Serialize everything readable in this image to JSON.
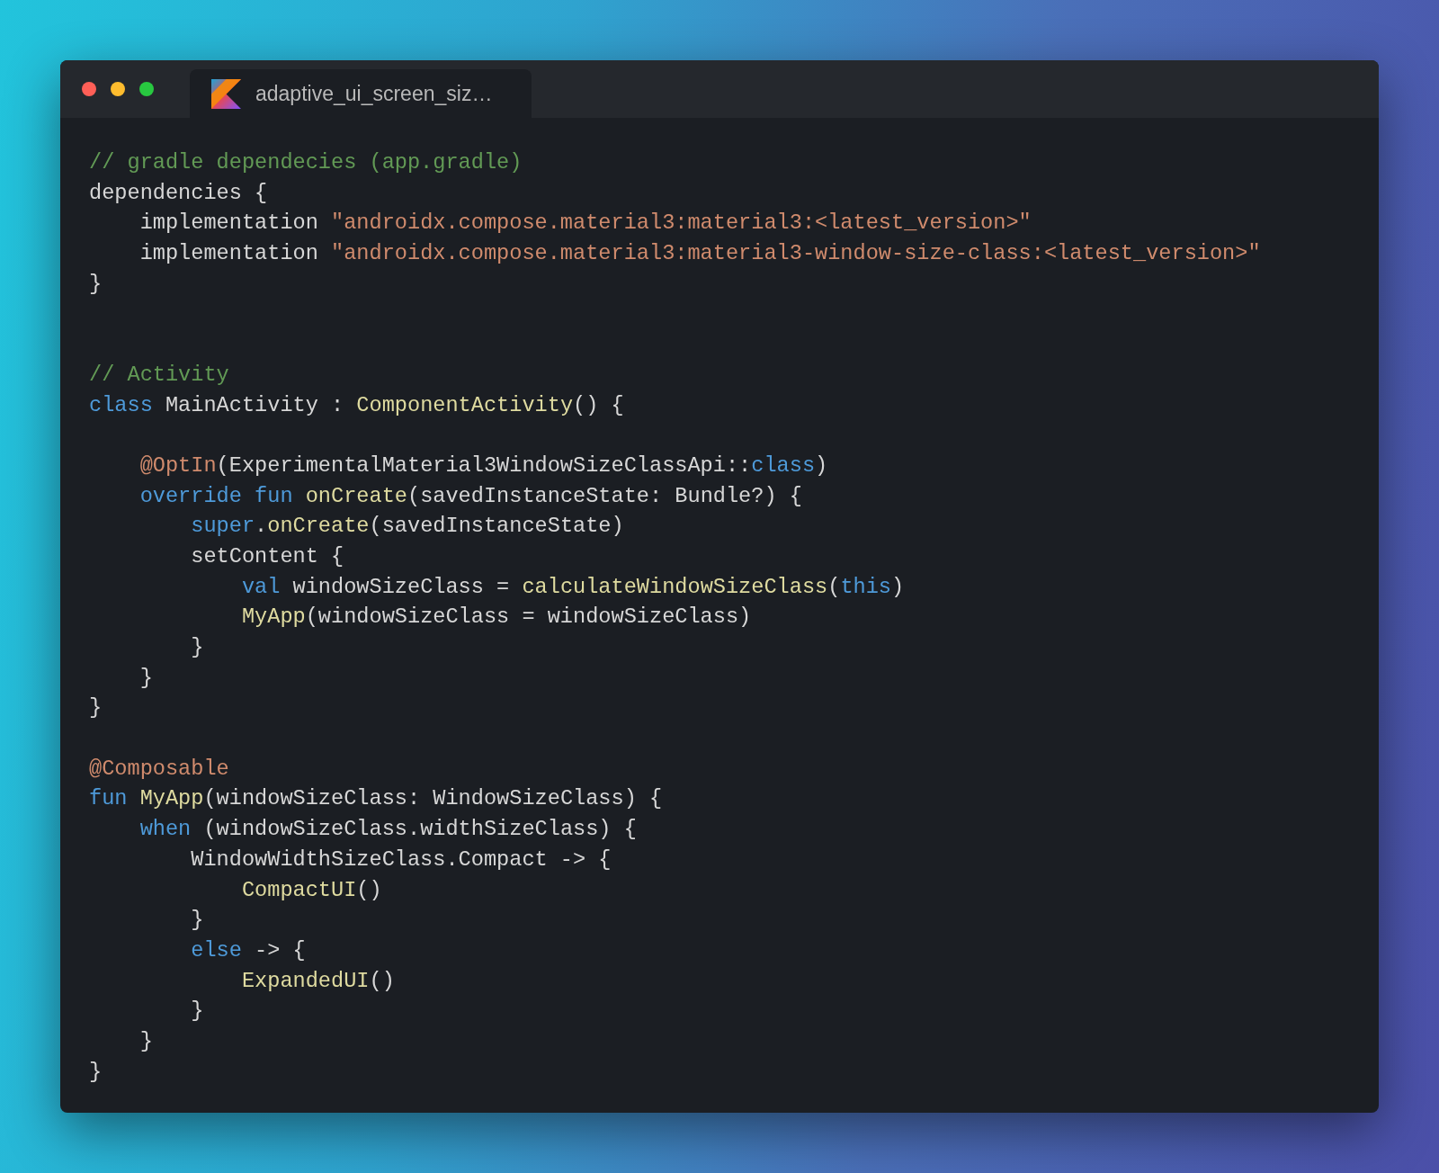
{
  "window": {
    "traffic_lights": [
      {
        "color": "#ff5f57"
      },
      {
        "color": "#febc2e"
      },
      {
        "color": "#28c840"
      }
    ],
    "tab": {
      "title": "adaptive_ui_screen_siz…"
    }
  },
  "code": [
    {
      "kind": "code",
      "tokens": [
        {
          "kind": "comment",
          "text": "// gradle dependecies (app.gradle)"
        }
      ]
    },
    {
      "kind": "code",
      "tokens": [
        {
          "kind": "plain",
          "text": "dependencies {"
        }
      ]
    },
    {
      "kind": "code",
      "tokens": [
        {
          "kind": "plain",
          "text": "    implementation "
        },
        {
          "kind": "string",
          "text": "\"androidx.compose.material3:material3:<latest_version>\""
        }
      ]
    },
    {
      "kind": "code",
      "tokens": [
        {
          "kind": "plain",
          "text": "    implementation "
        },
        {
          "kind": "string",
          "text": "\"androidx.compose.material3:material3-window-size-class:<latest_version>\""
        }
      ]
    },
    {
      "kind": "code",
      "tokens": [
        {
          "kind": "plain",
          "text": "}"
        }
      ]
    },
    {
      "kind": "blank"
    },
    {
      "kind": "blank"
    },
    {
      "kind": "code",
      "tokens": [
        {
          "kind": "comment",
          "text": "// Activity"
        }
      ]
    },
    {
      "kind": "code",
      "tokens": [
        {
          "kind": "keyword",
          "text": "class"
        },
        {
          "kind": "plain",
          "text": " MainActivity : "
        },
        {
          "kind": "function",
          "text": "ComponentActivity"
        },
        {
          "kind": "plain",
          "text": "() {"
        }
      ]
    },
    {
      "kind": "blank"
    },
    {
      "kind": "code",
      "tokens": [
        {
          "kind": "annotation",
          "text": "    @OptIn"
        },
        {
          "kind": "plain",
          "text": "(ExperimentalMaterial3WindowSizeClassApi::"
        },
        {
          "kind": "keyword",
          "text": "class"
        },
        {
          "kind": "plain",
          "text": ")"
        }
      ]
    },
    {
      "kind": "code",
      "tokens": [
        {
          "kind": "keyword",
          "text": "    override fun "
        },
        {
          "kind": "function",
          "text": "onCreate"
        },
        {
          "kind": "plain",
          "text": "(savedInstanceState: Bundle?) {"
        }
      ]
    },
    {
      "kind": "code",
      "tokens": [
        {
          "kind": "keyword",
          "text": "        super"
        },
        {
          "kind": "plain",
          "text": "."
        },
        {
          "kind": "function",
          "text": "onCreate"
        },
        {
          "kind": "plain",
          "text": "(savedInstanceState)"
        }
      ]
    },
    {
      "kind": "code",
      "tokens": [
        {
          "kind": "plain",
          "text": "        setContent {"
        }
      ]
    },
    {
      "kind": "code",
      "tokens": [
        {
          "kind": "keyword",
          "text": "            val"
        },
        {
          "kind": "plain",
          "text": " windowSizeClass = "
        },
        {
          "kind": "function",
          "text": "calculateWindowSizeClass"
        },
        {
          "kind": "plain",
          "text": "("
        },
        {
          "kind": "keyword",
          "text": "this"
        },
        {
          "kind": "plain",
          "text": ")"
        }
      ]
    },
    {
      "kind": "code",
      "tokens": [
        {
          "kind": "function",
          "text": "            MyApp"
        },
        {
          "kind": "plain",
          "text": "(windowSizeClass = windowSizeClass)"
        }
      ]
    },
    {
      "kind": "code",
      "tokens": [
        {
          "kind": "plain",
          "text": "        }"
        }
      ]
    },
    {
      "kind": "code",
      "tokens": [
        {
          "kind": "plain",
          "text": "    }"
        }
      ]
    },
    {
      "kind": "code",
      "tokens": [
        {
          "kind": "plain",
          "text": "}"
        }
      ]
    },
    {
      "kind": "blank"
    },
    {
      "kind": "code",
      "tokens": [
        {
          "kind": "annotation",
          "text": "@Composable"
        }
      ]
    },
    {
      "kind": "code",
      "tokens": [
        {
          "kind": "keyword",
          "text": "fun "
        },
        {
          "kind": "function",
          "text": "MyApp"
        },
        {
          "kind": "plain",
          "text": "(windowSizeClass: WindowSizeClass) {"
        }
      ]
    },
    {
      "kind": "code",
      "tokens": [
        {
          "kind": "keyword",
          "text": "    when"
        },
        {
          "kind": "plain",
          "text": " (windowSizeClass.widthSizeClass) {"
        }
      ]
    },
    {
      "kind": "code",
      "tokens": [
        {
          "kind": "plain",
          "text": "        WindowWidthSizeClass.Compact -> {"
        }
      ]
    },
    {
      "kind": "code",
      "tokens": [
        {
          "kind": "function",
          "text": "            CompactUI"
        },
        {
          "kind": "plain",
          "text": "()"
        }
      ]
    },
    {
      "kind": "code",
      "tokens": [
        {
          "kind": "plain",
          "text": "        }"
        }
      ]
    },
    {
      "kind": "code",
      "tokens": [
        {
          "kind": "keyword",
          "text": "        else"
        },
        {
          "kind": "plain",
          "text": " -> {"
        }
      ]
    },
    {
      "kind": "code",
      "tokens": [
        {
          "kind": "function",
          "text": "            ExpandedUI"
        },
        {
          "kind": "plain",
          "text": "()"
        }
      ]
    },
    {
      "kind": "code",
      "tokens": [
        {
          "kind": "plain",
          "text": "        }"
        }
      ]
    },
    {
      "kind": "code",
      "tokens": [
        {
          "kind": "plain",
          "text": "    }"
        }
      ]
    },
    {
      "kind": "code",
      "tokens": [
        {
          "kind": "plain",
          "text": "}"
        }
      ]
    }
  ]
}
